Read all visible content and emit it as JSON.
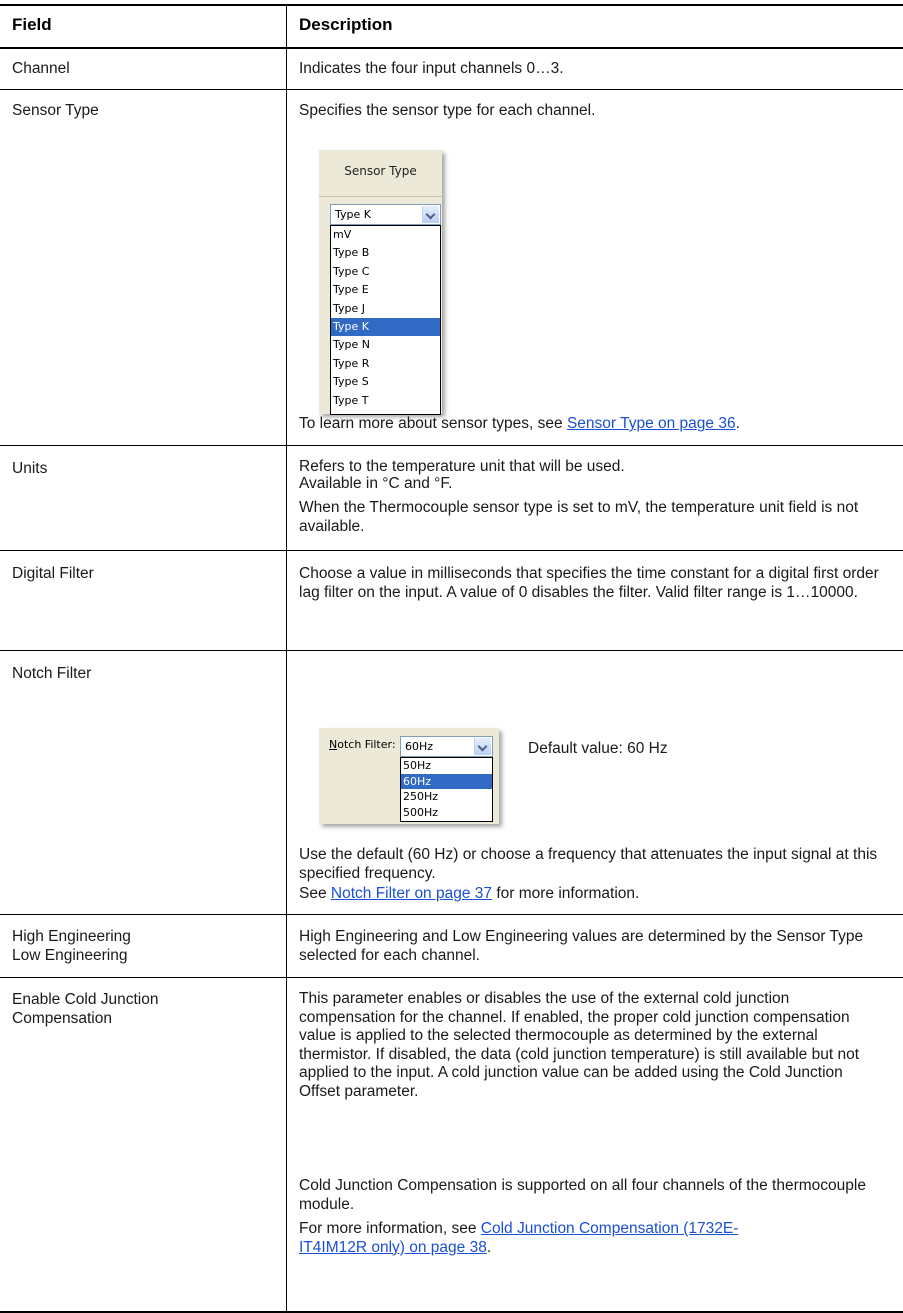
{
  "header": {
    "field": "Field",
    "description": "Description"
  },
  "rows": {
    "channel": {
      "field": "Channel",
      "desc": "Indicates the four input channels 0…3."
    },
    "sensor_type": {
      "field": "Sensor Type",
      "desc": "Specifies the sensor type for each channel.",
      "widget": {
        "title": "Sensor Type",
        "selected": "Type K",
        "options": [
          "mV",
          "Type B",
          "Type C",
          "Type E",
          "Type J",
          "Type K",
          "Type N",
          "Type R",
          "Type S",
          "Type T"
        ]
      },
      "note_prefix": "To learn more about sensor types, see ",
      "note_link": "Sensor Type on page 36",
      "note_suffix": "."
    },
    "units": {
      "field": "Units",
      "line1": "Refers to the temperature unit that will be used.",
      "line2": "Available in °C and °F.",
      "para2": "When the Thermocouple sensor type is set to mV, the temperature unit field is not available."
    },
    "digital_filter": {
      "field": "Digital Filter",
      "desc": "Choose a value in milliseconds that specifies the time constant for a digital first order lag filter on the input. A value of 0 disables the filter. Valid filter range is 1…10000."
    },
    "notch_filter": {
      "field": "Notch Filter",
      "widget": {
        "label_underlined": "N",
        "label_rest": "otch Filter:",
        "selected": "60Hz",
        "options": [
          "50Hz",
          "60Hz",
          "250Hz",
          "500Hz"
        ]
      },
      "default_text": "Default value: 60 Hz",
      "para1": "Use the default (60 Hz) or choose a frequency that attenuates the input signal at this specified frequency.",
      "para2_prefix": "See ",
      "para2_link": "Notch Filter on page 37",
      "para2_suffix": " for more information."
    },
    "engineering": {
      "field_line1": "High Engineering",
      "field_line2": "Low Engineering",
      "desc": "High Engineering and Low Engineering values are determined by the Sensor Type selected for each channel."
    },
    "cjc": {
      "field_line1": "Enable Cold Junction",
      "field_line2": "Compensation",
      "para1": "This parameter enables or disables the use of the external cold junction compensation for the channel. If enabled, the proper cold junction compensation value is applied to the selected thermocouple as determined by the external thermistor. If disabled, the data (cold junction temperature) is still available but not applied to the input. A cold junction value can be added using the Cold Junction Offset parameter.",
      "para2": "Cold Junction Compensation is supported on all four channels of the thermocouple module.",
      "para3_prefix": "For more information, see ",
      "para3_link": "Cold Junction Compensation (1732E-IT4IM12R only) on page 38",
      "para3_suffix": "."
    }
  }
}
